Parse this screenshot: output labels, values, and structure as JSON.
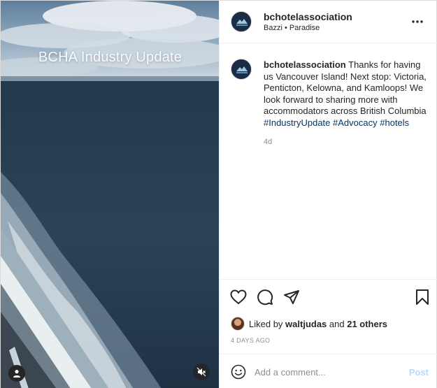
{
  "media": {
    "overlay_title": "BCHA Industry Update"
  },
  "header": {
    "username": "bchotelassociation",
    "location": "Bazzi • Paradise"
  },
  "caption": {
    "username": "bchotelassociation",
    "text": " Thanks for having us Vancouver Island! Next stop: Victoria, Penticton, Kelowna, and Kamloops! We look forward to sharing more with accommodators across British Columbia ",
    "hashtags": [
      "#IndustryUpdate",
      "#Advocacy",
      "#hotels"
    ],
    "age": "4d"
  },
  "likes": {
    "prefix": "Liked by ",
    "liker": "waltjudas",
    "middle": " and ",
    "others": "21 others"
  },
  "timestamp": "4 DAYS AGO",
  "comment": {
    "placeholder": "Add a comment...",
    "post_label": "Post"
  },
  "colors": {
    "hashtag": "#00376b",
    "post_disabled": "#b3dbff",
    "muted_text": "#8e8e8e"
  },
  "icons": [
    "user-tag-icon",
    "mute-icon",
    "more-options-icon",
    "heart-icon",
    "comment-icon",
    "share-icon",
    "bookmark-icon",
    "emoji-icon"
  ]
}
